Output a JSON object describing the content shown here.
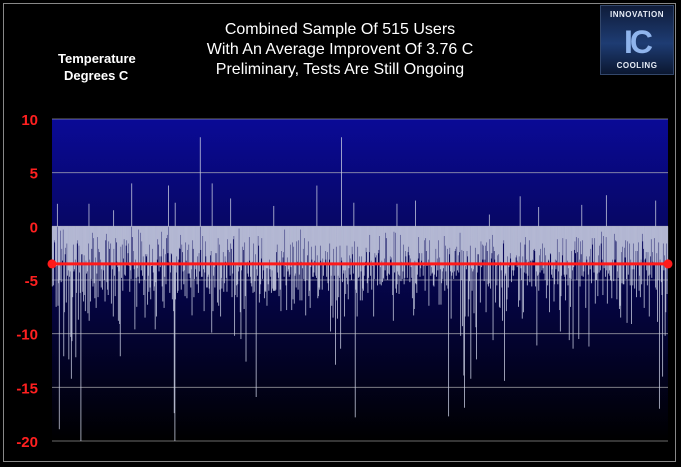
{
  "title_lines": [
    "Combined Sample Of 515 Users",
    "With An Average Improvent Of 3.76 C",
    "Preliminary, Tests Are Still Ongoing"
  ],
  "ylabel_lines": [
    "Temperature",
    "Degrees C"
  ],
  "logo": {
    "top": "INNOVATION",
    "mark": "IC",
    "bottom": "COOLING"
  },
  "colors": {
    "tick_label": "#ff2020",
    "bar": "#c8cde0",
    "average_line": "#ff1a1a",
    "plot_top": "#0a0a96",
    "plot_bottom": "#000000",
    "grid": "#c0c0c0"
  },
  "chart_data": {
    "type": "bar",
    "title": "Combined Sample Of 515 Users With An Average Improvent Of 3.76 C Preliminary, Tests Are Still Ongoing",
    "ylabel": "Temperature Degrees C",
    "xlabel": "",
    "ylim": [
      -20,
      10
    ],
    "yticks": [
      10,
      5,
      0,
      -5,
      -10,
      -15,
      -20
    ],
    "grid": true,
    "n_users": 515,
    "average": -3.5,
    "series": [
      {
        "values": [
          -5.6,
          -3.7,
          -5.5,
          -1.3,
          -1.5,
          -3.6,
          -7.5,
          -3.7,
          2.1,
          -7.4,
          -5.3,
          -18.9,
          -5,
          -0.4,
          -5.2,
          -2.1,
          -3.2,
          -0.3,
          -12.1,
          -8,
          -2.6,
          -2,
          -7.1,
          -1.6,
          -4.6,
          -4.1,
          -12.4,
          -4.7,
          -4.2,
          -10.3,
          -14.2,
          -10.7,
          -6.6,
          -1.7,
          -4.2,
          -4,
          -3.1,
          -12.2,
          -6.2,
          -1.6,
          -1.3,
          -8.7,
          -1.8,
          -4.3,
          -6.2,
          -20,
          -2.6,
          -2.6,
          -6.1,
          -7,
          -2.7,
          -6.4,
          -7.9,
          -3.2,
          -4.4,
          -4.2,
          -8.1,
          -1.6,
          -8.8,
          -3.1,
          -7,
          -4.9,
          -2.1,
          -0.6,
          -5.6,
          -1.1,
          -5.3,
          -6.7,
          -2.9,
          -7.6,
          -4.4,
          -1,
          -6.6,
          -2.1,
          -2.4,
          -5.1,
          -3.1,
          -5.7,
          -4,
          -5.9,
          -3.4,
          -4.1,
          -5,
          -7,
          -1.3,
          -0.7,
          -5.2,
          -5.9,
          -6.4,
          -1.4,
          -2.1,
          -3.6,
          -1.6,
          -7.2,
          -3.6,
          -4,
          -8.4,
          -2.1,
          -4.6,
          -6.5,
          -1.1,
          -1.5,
          -3.3,
          -3.8,
          -8.8,
          -4.2,
          -9.1,
          -12.1,
          -1.9,
          -4.8,
          -1.7,
          -6,
          -3,
          -1.2,
          -4.5,
          -4.6,
          -1.8,
          -1.3,
          -3.4,
          -2.5,
          -1.6,
          -3.7,
          -6.1,
          -4.1,
          -4.9,
          4,
          -1,
          -3.6,
          -2.3,
          -4,
          -9.6,
          -3.1,
          -4.8,
          -7.5,
          -3.9,
          -4.7,
          -0.3,
          -5.3,
          -3.4,
          -0.6,
          -4.1,
          -1.4,
          -4.6,
          -2.8,
          -6.4,
          -5,
          -8.5,
          -2.6,
          -2.8,
          -2.6,
          -7.3,
          -4.6,
          -6.1,
          -1.7,
          -5.7,
          -6.8,
          -3.7,
          -3.7,
          -2.1,
          -4.3,
          -6,
          -5.6,
          -9.6,
          -5.2,
          -8.4,
          -3.1,
          -1.2,
          -1.7,
          -4.2,
          -2.8,
          -3.8,
          -2.8,
          -0.5,
          -5.6,
          -7,
          -2.1,
          -7.6,
          -4.7,
          -2.6,
          -5.4,
          -1.1,
          -0.8,
          -2.5,
          3.8,
          -3.3,
          -6.2,
          -4.3,
          -2.5,
          -2.6,
          -6.8,
          -3.7,
          -7.9,
          -17.4,
          -20,
          -6.8,
          -4.3,
          -2.8,
          -6.2,
          -6,
          -3.1,
          -2,
          -2.1,
          -0.8,
          -5.9,
          -1.7,
          -2.4,
          -4.2,
          -5.4,
          -4.1,
          -6.5,
          -1.5,
          -3.2,
          -6.7,
          -2.2,
          -4.4,
          -1.7,
          -4.4,
          -4.8,
          -5.7,
          -4,
          -8.3,
          -1.3,
          -2.1,
          -6.6,
          -4.9,
          -3.5,
          -4,
          -4.7,
          -5.4,
          -2.8,
          -6.2,
          -2.5,
          -4.2,
          8.3,
          -2.2,
          -4.7,
          -4.7,
          -0.9,
          -4,
          -7.9,
          -4.3,
          -1.4,
          -2.8,
          -5.7,
          -5.7,
          -4.7,
          -4.5,
          -5.8,
          -6.3,
          -2.7,
          -2.3,
          -9.9,
          -3.3,
          -7.9,
          -4.6,
          -3.8,
          -5.7,
          -2.5,
          -3.5,
          -2.5,
          -7.1,
          -1.1,
          -7.4,
          -1.7,
          -5.9,
          -8.4,
          -4.8,
          -5.8,
          -3.6,
          -2.4,
          -6.1,
          -5.3,
          -2.8,
          -3.3,
          -4.8,
          -6.1,
          -1.2,
          -2.2,
          -3.4,
          -2.4,
          -4.6,
          -1.6,
          -2.1,
          -6.6,
          -4.4,
          -1.2,
          -0.9,
          -10.2,
          -6.4,
          -3.5,
          -5.5,
          -6.6,
          -5.4,
          -4.2,
          -0.2,
          -3.8,
          -8,
          -10.5,
          -4.1,
          -3.6,
          -1.9,
          -2.2,
          -7.7,
          -1.5,
          -6.5,
          -12.6,
          -3.5,
          -3.3,
          -4.4,
          -4.7,
          -1,
          -3.2,
          -4.7,
          -5.3,
          -5.6,
          -3.3,
          -6.2,
          -1.6,
          -6.1,
          -5.1,
          -2.6,
          -15.9,
          -4,
          -4.6,
          -0.9,
          -1.8,
          -7.1,
          -6.3,
          -5.4,
          -3,
          -1.1,
          -4.9,
          -4.1,
          -3.4,
          -6.7,
          -6,
          -6.1,
          -3.9,
          -7.4,
          -3.9,
          -5.4,
          -6,
          -3.1,
          -4,
          -4.7,
          -6.2,
          -4.1,
          -5.8,
          -6,
          -6,
          -6,
          -6,
          -5.9,
          -2.4,
          -1.7,
          -4.3,
          -4.8,
          -6.5,
          -3.2,
          -5.9,
          -7.9,
          -2.3,
          -3.5,
          -2.9,
          -2.4,
          -4.7,
          -0.3,
          -3.7,
          -5.5,
          -7.8,
          -2.9,
          -4.2,
          -4,
          -4.7,
          -4.5,
          -1.7,
          -3.8,
          -7.8,
          -1.5,
          -6.8,
          -1.9,
          -7.2,
          -4.6,
          -4.4,
          -5.7,
          -1.4,
          -3.3,
          -5.9,
          -1.3,
          -4.5,
          -6.9,
          -0.3,
          -3.3,
          -6.9,
          -3.9,
          -2.1,
          -4.9,
          -1.1,
          -5.1,
          -8.3,
          -3.4,
          -5,
          -2.7,
          -1.4,
          -6.5,
          -6,
          -7.6,
          -3.8,
          -1.9,
          -3.1,
          -4.7,
          -4.7,
          -4.3,
          -3.2,
          -1.8,
          -4.6,
          -4.8,
          -2.7,
          -6.7,
          -6.5,
          -5.7,
          -5.9,
          -1.8,
          -3.2,
          -3.5,
          -5.9,
          -3,
          -4.6,
          -3.4,
          -3.6,
          -2.3,
          -3.1,
          -4.7,
          -2.4,
          -5.3,
          -6,
          -3.1,
          -1.6,
          -9.8,
          -4.6,
          -7.4,
          -3.4,
          -8.5,
          -2.1,
          -4.6,
          -3.5,
          -12.9,
          -1.9,
          -6.9,
          -8.6,
          -4.6,
          -6.6,
          -4.8,
          -1.8,
          -11.4,
          -2.9,
          -3.2,
          -5.2,
          -4.4,
          -4.1,
          -8.4,
          -4.1,
          -6.3,
          -4.8,
          -1.8,
          -5.4,
          -6.8,
          -3.9,
          -2.7,
          -4.5,
          -3,
          -5,
          -1.9,
          -2.6,
          -4.4,
          -3.6,
          -1.4,
          -17.8,
          -5.9,
          -6.2,
          -8.4,
          -1.9,
          -4.8,
          -4.7,
          -2.8,
          -6.9,
          -4.2,
          -2.8,
          -6.9,
          -5.8,
          -6,
          -4.6,
          -3.7,
          -3.3,
          -2,
          -2.4,
          -5.3,
          -6.2,
          -4.8,
          -2.4,
          -0.8,
          -4.6,
          -3.2,
          -5.9,
          -3.4,
          -3.7,
          -8.4,
          -4.9,
          -2.5,
          -2.9,
          -2.7,
          -3.5,
          -5.5,
          -2.5,
          -2.2,
          -0.9,
          -5.4,
          -3.8,
          -5.5,
          -3.2,
          -5.2,
          -4.8,
          -4.9,
          -3,
          -4.1,
          -0.6,
          -1.1,
          -4.6,
          -5,
          -4.4,
          -3.5,
          -4.5,
          -2.8,
          -3.1,
          -2.9,
          -3.6,
          -6.4,
          -8.8,
          -0.5,
          -4.3,
          -0.6,
          -5.8,
          -6.2,
          -5.4,
          -4.2,
          -4.5,
          -6.3,
          -4.6,
          -0.8,
          -5.1,
          -3.3,
          -4.9,
          -4.2,
          -1.7,
          -5.4,
          -4.8,
          -2.3,
          -2.8,
          -3.5,
          -4.8,
          -2.4,
          -1.9,
          -2.7,
          -5.2,
          -3,
          -3.8,
          -4.8,
          -6.7,
          -3.4,
          -8.3,
          -7.7,
          -3.2,
          -5.3,
          -5.4,
          -6.2,
          -4.5,
          -3,
          -1,
          -2.5,
          -4.7,
          -3.9,
          -3.2,
          -2.5,
          -3.6,
          -4.6,
          -3.7,
          -1.3,
          -6,
          -1.1,
          -2.3,
          -3.7,
          -3.4,
          -3.1,
          -7.4,
          -1.3,
          -3.5,
          -4.6,
          -3.8,
          -4.4,
          -4.3,
          -5.5,
          -5.6,
          -4.5,
          -3.6,
          -2.1,
          -4.7,
          -3,
          -4.1,
          -1.3,
          -7.3,
          -2.9,
          -4,
          -7.3,
          -5.3,
          -4.2,
          -4.9,
          -3.9,
          -0.9,
          -6,
          -1.8,
          -4.2,
          -5.5,
          -2.1,
          -5.8,
          -17.7,
          -2.6,
          -2,
          -4.2,
          -8.6,
          -4.6,
          -4.3,
          -3.6,
          -4.9,
          -4.2,
          -2.3,
          -2.1,
          -4.6,
          -1.9,
          -4.1,
          -2.7,
          -4.3,
          -2.4,
          -0.6,
          -10.2,
          -5,
          -2.2,
          -9.3,
          -2.3,
          -13.9,
          -16.9,
          -8.4,
          -3.7,
          -4,
          -2.3,
          -2.8,
          -8.4,
          -6.8,
          -5.1,
          -1.8,
          -14.2,
          -3.9,
          -6,
          -4.2,
          -4,
          -8.1,
          -3.4,
          -2,
          -9.4,
          -12.4,
          -4.3,
          -2.6,
          -2.6,
          -3.7,
          -3.4,
          -7.1,
          -1.4,
          -3.8,
          -1.7,
          -3.1,
          -1.8,
          -5.1,
          -3.1,
          -1.8,
          -8,
          -1.5,
          -2.3,
          -5.4,
          -5.6,
          -5.3,
          -1.2,
          -5.8,
          -3,
          -2.5,
          -0.8,
          -10.6,
          -1.9,
          -2.3,
          -3.1,
          -7.1,
          -3.7,
          -5.5,
          -2.7,
          -3.6,
          -2.6,
          -7.5,
          -7.6,
          -3.3,
          -4.1,
          -5.7,
          -8.8,
          -1.6,
          -1.3,
          -14.4,
          -4.6,
          -4.4,
          -7.9,
          -6.8,
          -2.8,
          -5.7,
          -3.8,
          -3.4,
          -2.5,
          -3,
          -5.2,
          -3.6,
          -4.1,
          -4.6,
          -4.1,
          -3.5,
          -3.4,
          -2.9,
          -2.7,
          -3.8,
          -3.2,
          -7.5,
          -2.8,
          -6.9,
          -1.5,
          -3.9,
          -5,
          -8.6,
          -2.8,
          -8,
          -4.3,
          -1.7,
          -1,
          -4.4,
          -3.1,
          -5.5,
          -4.6,
          -3.3,
          -1.3,
          -5.2,
          -3.2,
          -3.2,
          -5.6,
          -3.1,
          -3.2,
          -2.2,
          -2.1,
          -2.3,
          -5.6,
          -4.2,
          -11.1,
          -4.6,
          -4.5,
          -6,
          -2.7,
          -4.3,
          -2.1,
          -3.3,
          -4.1,
          -1.6,
          -3.9,
          -4.4,
          -2,
          -5,
          -2.7,
          -6.7,
          -3.6,
          -5.5,
          -3.1,
          -3.2,
          -8,
          -2.5,
          -2.6,
          -4.5,
          -4,
          -4.8,
          -3.4,
          -7,
          -5.4,
          -3.1,
          -4,
          -3.2,
          -1.2,
          -5.4,
          -4.2,
          -2.4,
          -7.8,
          -9.8,
          -6.5,
          -4.6,
          -2.7,
          -1.1,
          -3.6,
          -4.5,
          -4.7,
          -6.9,
          -1.2,
          -4.5,
          -3.2,
          -5.5,
          -3.9,
          -10.6,
          -4.8,
          -7.5,
          -4.9,
          -2.3,
          -4.1,
          -11.4,
          -3.8,
          -2.2,
          -1.4,
          -2.5,
          -1,
          -5,
          -2.4,
          -1.1,
          -10.5,
          -3.1,
          -5.6,
          -1.4,
          -2.6,
          -4.6,
          -1.3,
          -4.7,
          -4.2,
          -3.6,
          -3.5,
          -7.6,
          -2.8,
          -3.1,
          -3.4,
          -4.5,
          -11.2,
          -2.8,
          -4,
          -2.1,
          -5.3,
          -1.1,
          -1.7,
          -3.3,
          -4.3,
          -1.1,
          -7.2,
          -5,
          -5,
          -4.4,
          -6.5,
          -2.7,
          -4.3,
          -1.8,
          -4.1,
          -1.6,
          -0.5,
          -3.1,
          -6.4,
          -0.9,
          -3.9,
          -3.5,
          -4.7,
          -1,
          -4.1,
          -7.2,
          -3.4,
          -4.4,
          -4.1,
          -4.6,
          -5,
          -5.1,
          -6.7,
          -3.1,
          -3.6,
          -5.1,
          -0.7,
          -3.1,
          -1.3,
          -1.4,
          -6.8,
          -4.2,
          -4.8,
          -3.6,
          -7.7,
          -7.4,
          -8.5,
          -2.4,
          -5.3,
          -1.9,
          -5.4,
          -5.4,
          -2,
          -2.9,
          -1.3,
          -4.9,
          -9,
          -1.4,
          -4.5,
          -3.4,
          -1.6,
          -5.5,
          -3.1,
          -9.1,
          -4,
          -5.5,
          -1.6,
          -4,
          -5.8,
          -3.5,
          -2.3,
          -6.6,
          -2.3,
          -3.6,
          -1.5,
          -6,
          -4.6,
          -6.6,
          -3.1,
          -5.4,
          -0.7,
          -1.4,
          -2.1,
          -7.6,
          -3.1,
          -3,
          -2.4,
          -4.1,
          -5.5,
          -2.4,
          -4.6,
          -8.4,
          -4.5,
          -2.8,
          -1.2,
          -4.8,
          -2.4,
          -3.3,
          -3.6,
          -1.1,
          -3.5,
          -5.7,
          -5.9,
          -2.5,
          -8.9,
          -5,
          -1.5,
          -17,
          -3.1,
          -3.5,
          -5.2,
          -6.4,
          -14,
          -1.6,
          -4.1,
          -2.7,
          -10.2,
          -8,
          -1.6,
          -6.3,
          -3.7
        ]
      }
    ],
    "spikes_up": [
      {
        "at": 0.06,
        "value": 2.1
      },
      {
        "at": 0.1,
        "value": 1.5
      },
      {
        "at": 0.2,
        "value": 2.2
      },
      {
        "at": 0.26,
        "value": 4
      },
      {
        "at": 0.29,
        "value": 2.6
      },
      {
        "at": 0.36,
        "value": 1.9
      },
      {
        "at": 0.43,
        "value": 3.8
      },
      {
        "at": 0.47,
        "value": 8.3
      },
      {
        "at": 0.49,
        "value": 2.2
      },
      {
        "at": 0.56,
        "value": 2.1
      },
      {
        "at": 0.59,
        "value": 2.4
      },
      {
        "at": 0.71,
        "value": 1.1
      },
      {
        "at": 0.76,
        "value": 2.8
      },
      {
        "at": 0.79,
        "value": 1.8
      },
      {
        "at": 0.86,
        "value": 2
      },
      {
        "at": 0.9,
        "value": 2.9
      },
      {
        "at": 0.98,
        "value": 2.4
      }
    ]
  }
}
